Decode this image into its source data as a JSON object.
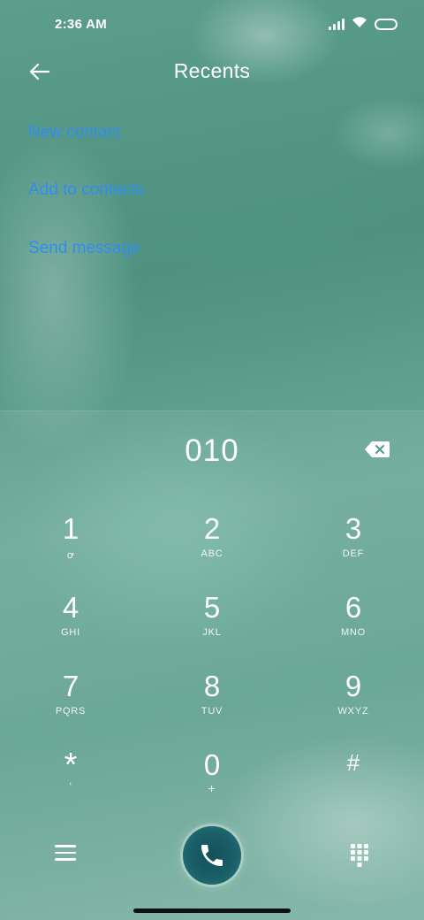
{
  "status_bar": {
    "time": "2:36 AM",
    "icons": [
      "signal-icon",
      "wifi-icon",
      "battery-icon"
    ]
  },
  "header": {
    "title": "Recents",
    "back_icon": "arrow-left-icon"
  },
  "actions": [
    {
      "label": "New contact"
    },
    {
      "label": "Add to contacts"
    },
    {
      "label": "Send message"
    }
  ],
  "colors": {
    "link": "#2e8bf0",
    "call_button": "#1a5f68"
  },
  "dialer": {
    "number": "010",
    "backspace_icon": "backspace-icon",
    "keys": [
      {
        "digit": "1",
        "letters": "ꝍ"
      },
      {
        "digit": "2",
        "letters": "ABC"
      },
      {
        "digit": "3",
        "letters": "DEF"
      },
      {
        "digit": "4",
        "letters": "GHI"
      },
      {
        "digit": "5",
        "letters": "JKL"
      },
      {
        "digit": "6",
        "letters": "MNO"
      },
      {
        "digit": "7",
        "letters": "PQRS"
      },
      {
        "digit": "8",
        "letters": "TUV"
      },
      {
        "digit": "9",
        "letters": "WXYZ"
      },
      {
        "digit": "*",
        "letters": ","
      },
      {
        "digit": "0",
        "letters": "+"
      },
      {
        "digit": "#",
        "letters": ""
      }
    ]
  },
  "bottom_bar": {
    "menu_icon": "menu-icon",
    "call_icon": "phone-icon",
    "dialpad_icon": "dialpad-icon"
  }
}
